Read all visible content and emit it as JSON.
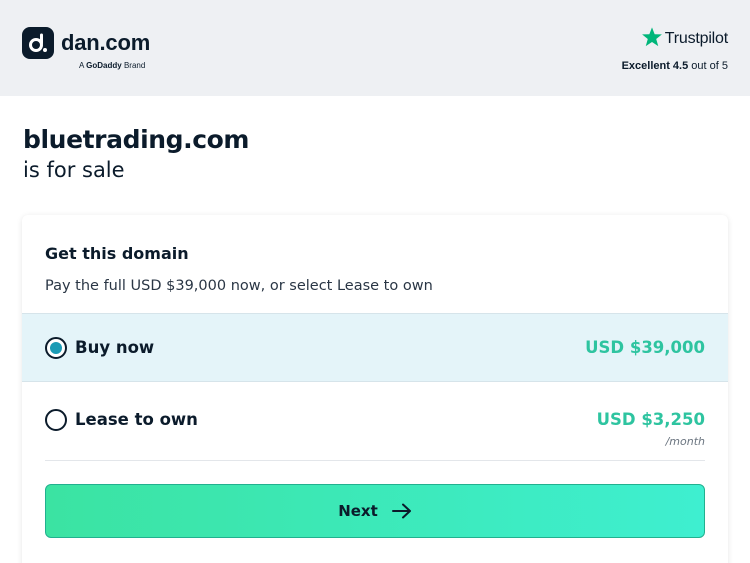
{
  "header": {
    "brand_name": "dan.com",
    "brand_prefix": "A",
    "brand_owner": "GoDaddy",
    "brand_suffix": "Brand",
    "logo_icon": "dan-logo-icon",
    "trustpilot": {
      "name": "Trustpilot",
      "star_icon": "star-icon",
      "star_color": "#00b67a",
      "rating_label": "Excellent 4.5",
      "rating_suffix": "out of 5"
    }
  },
  "listing": {
    "domain": "bluetrading.com",
    "subtitle": "is for sale"
  },
  "card": {
    "title": "Get this domain",
    "description": "Pay the full USD $39,000 now, or select Lease to own",
    "options": [
      {
        "label": "Buy now",
        "price": "USD $39,000",
        "selected": true
      },
      {
        "label": "Lease to own",
        "price": "USD $3,250",
        "period": "/month",
        "selected": false
      }
    ],
    "next_label": "Next",
    "next_icon": "arrow-right-icon"
  },
  "colors": {
    "accent_price": "#2ec4a0",
    "selected_row_bg": "#e4f4f9",
    "radio_dot": "#1b9bb5",
    "button_gradient": [
      "#3be3a2",
      "#3eefd0"
    ],
    "header_bg": "#eef0f3"
  }
}
